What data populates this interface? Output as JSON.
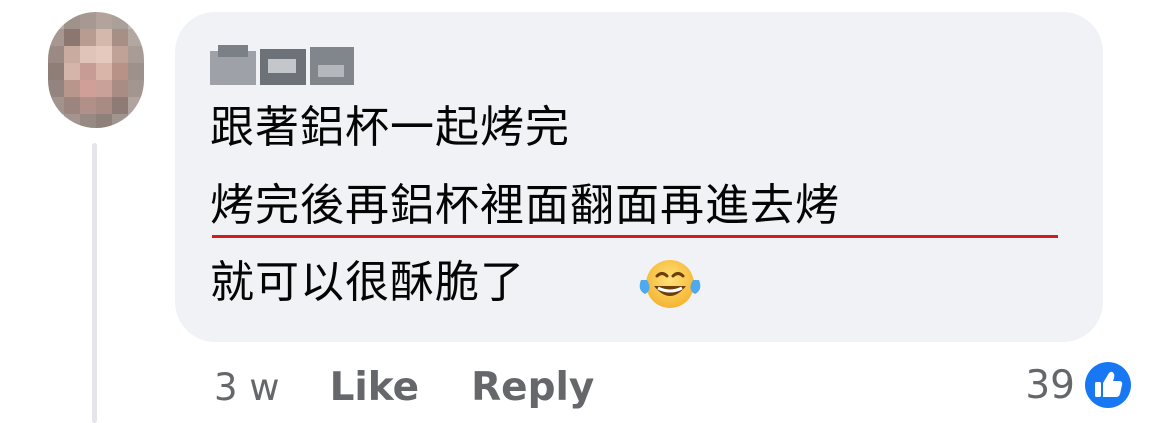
{
  "comment": {
    "author_name": "",
    "lines": [
      "跟著鋁杯一起烤完",
      "烤完後再鋁杯裡面翻面再進去烤",
      "就可以很酥脆了"
    ],
    "emoji": "face-with-tears-of-joy",
    "underline_color": "#d21b1b"
  },
  "actions": {
    "timestamp": "3 w",
    "like_label": "Like",
    "reply_label": "Reply"
  },
  "reactions": {
    "count": "39",
    "icon": "thumbs-up-icon",
    "badge_color": "#1877f2"
  },
  "colors": {
    "bubble": "#f0f2f5",
    "text": "#050505",
    "secondary_text": "#65676b"
  }
}
